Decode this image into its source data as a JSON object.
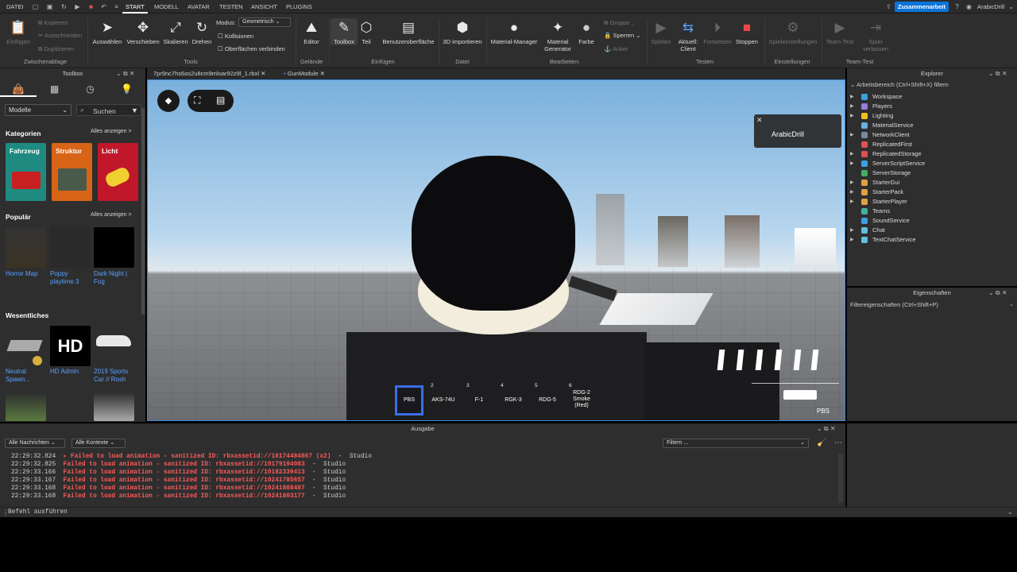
{
  "menubar": {
    "items": [
      "DATEI",
      "START",
      "MODELL",
      "AVATAR",
      "TESTEN",
      "ANSICHT",
      "PLUGINS"
    ],
    "collab_label": "Zusammenarbeit",
    "user": "ArabicDrill"
  },
  "ribbon": {
    "clipboard": {
      "items": [
        "Kopieren",
        "Ausschneiden",
        "Duplizieren"
      ],
      "paste": "Einfügen",
      "group": "Zwischenablage"
    },
    "tools": {
      "buttons": [
        "Auswählen",
        "Verschieben",
        "Skalieren",
        "Drehen"
      ],
      "mode_label": "Modus:",
      "mode_value": "Geometrisch",
      "collisions": "Kollisionen",
      "surfaces": "Oberflächen verbinden",
      "group": "Tools"
    },
    "terrain": {
      "editor": "Editor",
      "group": "Gelände"
    },
    "insert": {
      "toolbox": "Toolbox",
      "part": "Teil",
      "ui": "Benutzeroberfläche",
      "group": "Einfügen"
    },
    "file": {
      "import3d": "3D importieren",
      "group": "Datei"
    },
    "edit": {
      "material_manager": "Material-Manager",
      "material_generator": "Material\nGenerator",
      "color": "Farbe",
      "group_label": "Gruppe",
      "lock": "Sperren",
      "anchor": "Anker",
      "group": "Bearbeiten"
    },
    "test": {
      "play": "Spielen",
      "current_client": "Aktuell:\nClient",
      "continue": "Fortsetzen",
      "stop": "Stoppen",
      "group": "Testen"
    },
    "settings": {
      "game_settings": "Spieleinstellungen",
      "group": "Einstellungen"
    },
    "teamtest": {
      "team_test": "Team-Test",
      "leave_game": "Spiel\nverlassen",
      "group": "Team-Test"
    }
  },
  "toolbox": {
    "title": "Toolbox",
    "category_select": "Modelle",
    "search_placeholder": "Suchen",
    "categories_title": "Kategorien",
    "see_all": "Alles anzeigen >",
    "categories": [
      "Fahrzeug",
      "Struktur",
      "Licht"
    ],
    "popular_title": "Populär",
    "popular": [
      "Horror Map",
      "Poppy\nplaytime 3",
      "Dark Night |\nFog"
    ],
    "essentials_title": "Wesentliches",
    "essentials": [
      "Neutral\nSpawn...",
      "HD Admin",
      "2019 Sports\nCar // Rosh"
    ]
  },
  "tabs": [
    {
      "label": "7pr9nc7hs6os2u8cm9mloar92z9l_1.rbxl"
    },
    {
      "label": "GunModule"
    }
  ],
  "viewport": {
    "notification": "ArabicDrill",
    "ammo_label": "PBS",
    "hotbar": [
      {
        "num": "",
        "label": "PBS"
      },
      {
        "num": "2",
        "label": "AKS-74U"
      },
      {
        "num": "3",
        "label": "F-1"
      },
      {
        "num": "4",
        "label": "RGK-3"
      },
      {
        "num": "5",
        "label": "RDG-5"
      },
      {
        "num": "6",
        "label": "RDG-2\nSmoke\n(Red)"
      }
    ]
  },
  "explorer": {
    "title": "Explorer",
    "filter": "Arbeitsbereich (Ctrl+Shift+X) filtern",
    "items": [
      {
        "name": "Workspace",
        "color": "#3aa0e0",
        "expandable": true
      },
      {
        "name": "Players",
        "color": "#9b7be0",
        "expandable": true
      },
      {
        "name": "Lighting",
        "color": "#f0c020",
        "expandable": true
      },
      {
        "name": "MaterialService",
        "color": "#6ab0e0",
        "expandable": false
      },
      {
        "name": "NetworkClient",
        "color": "#7a8aa0",
        "expandable": true
      },
      {
        "name": "ReplicatedFirst",
        "color": "#e05050",
        "expandable": false
      },
      {
        "name": "ReplicatedStorage",
        "color": "#e05050",
        "expandable": true
      },
      {
        "name": "ServerScriptService",
        "color": "#3aa0e0",
        "expandable": true
      },
      {
        "name": "ServerStorage",
        "color": "#40b060",
        "expandable": false
      },
      {
        "name": "StarterGui",
        "color": "#e0a040",
        "expandable": true
      },
      {
        "name": "StarterPack",
        "color": "#e0a040",
        "expandable": true
      },
      {
        "name": "StarterPlayer",
        "color": "#e0a040",
        "expandable": true
      },
      {
        "name": "Teams",
        "color": "#40b0a0",
        "expandable": false
      },
      {
        "name": "SoundService",
        "color": "#3aa0e0",
        "expandable": false
      },
      {
        "name": "Chat",
        "color": "#60c0e0",
        "expandable": true
      },
      {
        "name": "TextChatService",
        "color": "#60c0e0",
        "expandable": true
      }
    ]
  },
  "properties": {
    "title": "Eigenschaften",
    "filter": "Filtereigenschaften (Ctrl+Shift+P)"
  },
  "output": {
    "title": "Ausgabe",
    "all_messages": "Alle Nachrichten",
    "all_contexts": "Alle Kontexte",
    "filter": "Filtern ...",
    "lines": [
      {
        "time": "22:29:32.824",
        "msg": "▸ Failed to load animation - sanitized ID: rbxassetid://10174484867 (x2)",
        "src": "  -  Studio"
      },
      {
        "time": "22:29:32.825",
        "msg": "Failed to load animation - sanitized ID: rbxassetid://10179194083",
        "src": "  -  Studio"
      },
      {
        "time": "22:29:33.166",
        "msg": "Failed to load animation - sanitized ID: rbxassetid://10182339413",
        "src": "  -  Studio"
      },
      {
        "time": "22:29:33.167",
        "msg": "Failed to load animation - sanitized ID: rbxassetid://10241785657",
        "src": "  -  Studio"
      },
      {
        "time": "22:29:33.168",
        "msg": "Failed to load animation - sanitized ID: rbxassetid://10241888487",
        "src": "  -  Studio"
      },
      {
        "time": "22:29:33.168",
        "msg": "Failed to load animation - sanitized ID: rbxassetid://10241803177",
        "src": "  -  Studio"
      }
    ]
  },
  "command": {
    "placeholder": "Befehl ausführen"
  }
}
